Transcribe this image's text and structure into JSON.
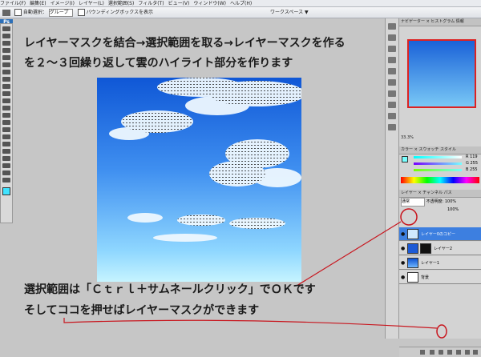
{
  "menu": [
    "ファイル(F)",
    "編集(E)",
    "イメージ(I)",
    "レイヤー(L)",
    "選択範囲(S)",
    "フィルタ(T)",
    "ビュー(V)",
    "ウィンドウ(W)",
    "ヘルプ(H)"
  ],
  "options": {
    "auto_select_label": "自動選択：",
    "auto_select_value": "グループ",
    "bbox_label": "バウンディングボックスを表示",
    "workspace": "ワークスペース ▼",
    "ps_logo": "Ps"
  },
  "panels": {
    "navigator_tabs": "ナビゲーター × ヒストグラム 情報",
    "zoom": "33.3%",
    "color_tabs": "カラー × スウォッチ スタイル",
    "color_values": [
      "R 119",
      "G 255",
      "B 255"
    ],
    "layers_tabs": "レイヤー × チャンネル パス",
    "blend_mode": "通常",
    "opacity": "不透明度: 100%",
    "fill": "100%",
    "layers": [
      "レイヤー0のコピー",
      "レイヤー2",
      "レイヤー1",
      "背景"
    ]
  },
  "annotations": {
    "line1": "レイヤーマスクを結合→選択範囲を取る→レイヤーマスクを作る",
    "line2": "を２～３回繰り返して雲のハイライト部分を作ります",
    "line3": "選択範囲は「Ｃｔｒｌ＋サムネールクリック」でＯＫです",
    "line4": "そしてココを押せばレイヤーマスクができます"
  },
  "colors": {
    "sky_top": "#0f57d6",
    "sky_bottom": "#c6f4ff",
    "annotation_red": "#c8161e",
    "layer_selected": "#3d7fe0"
  }
}
